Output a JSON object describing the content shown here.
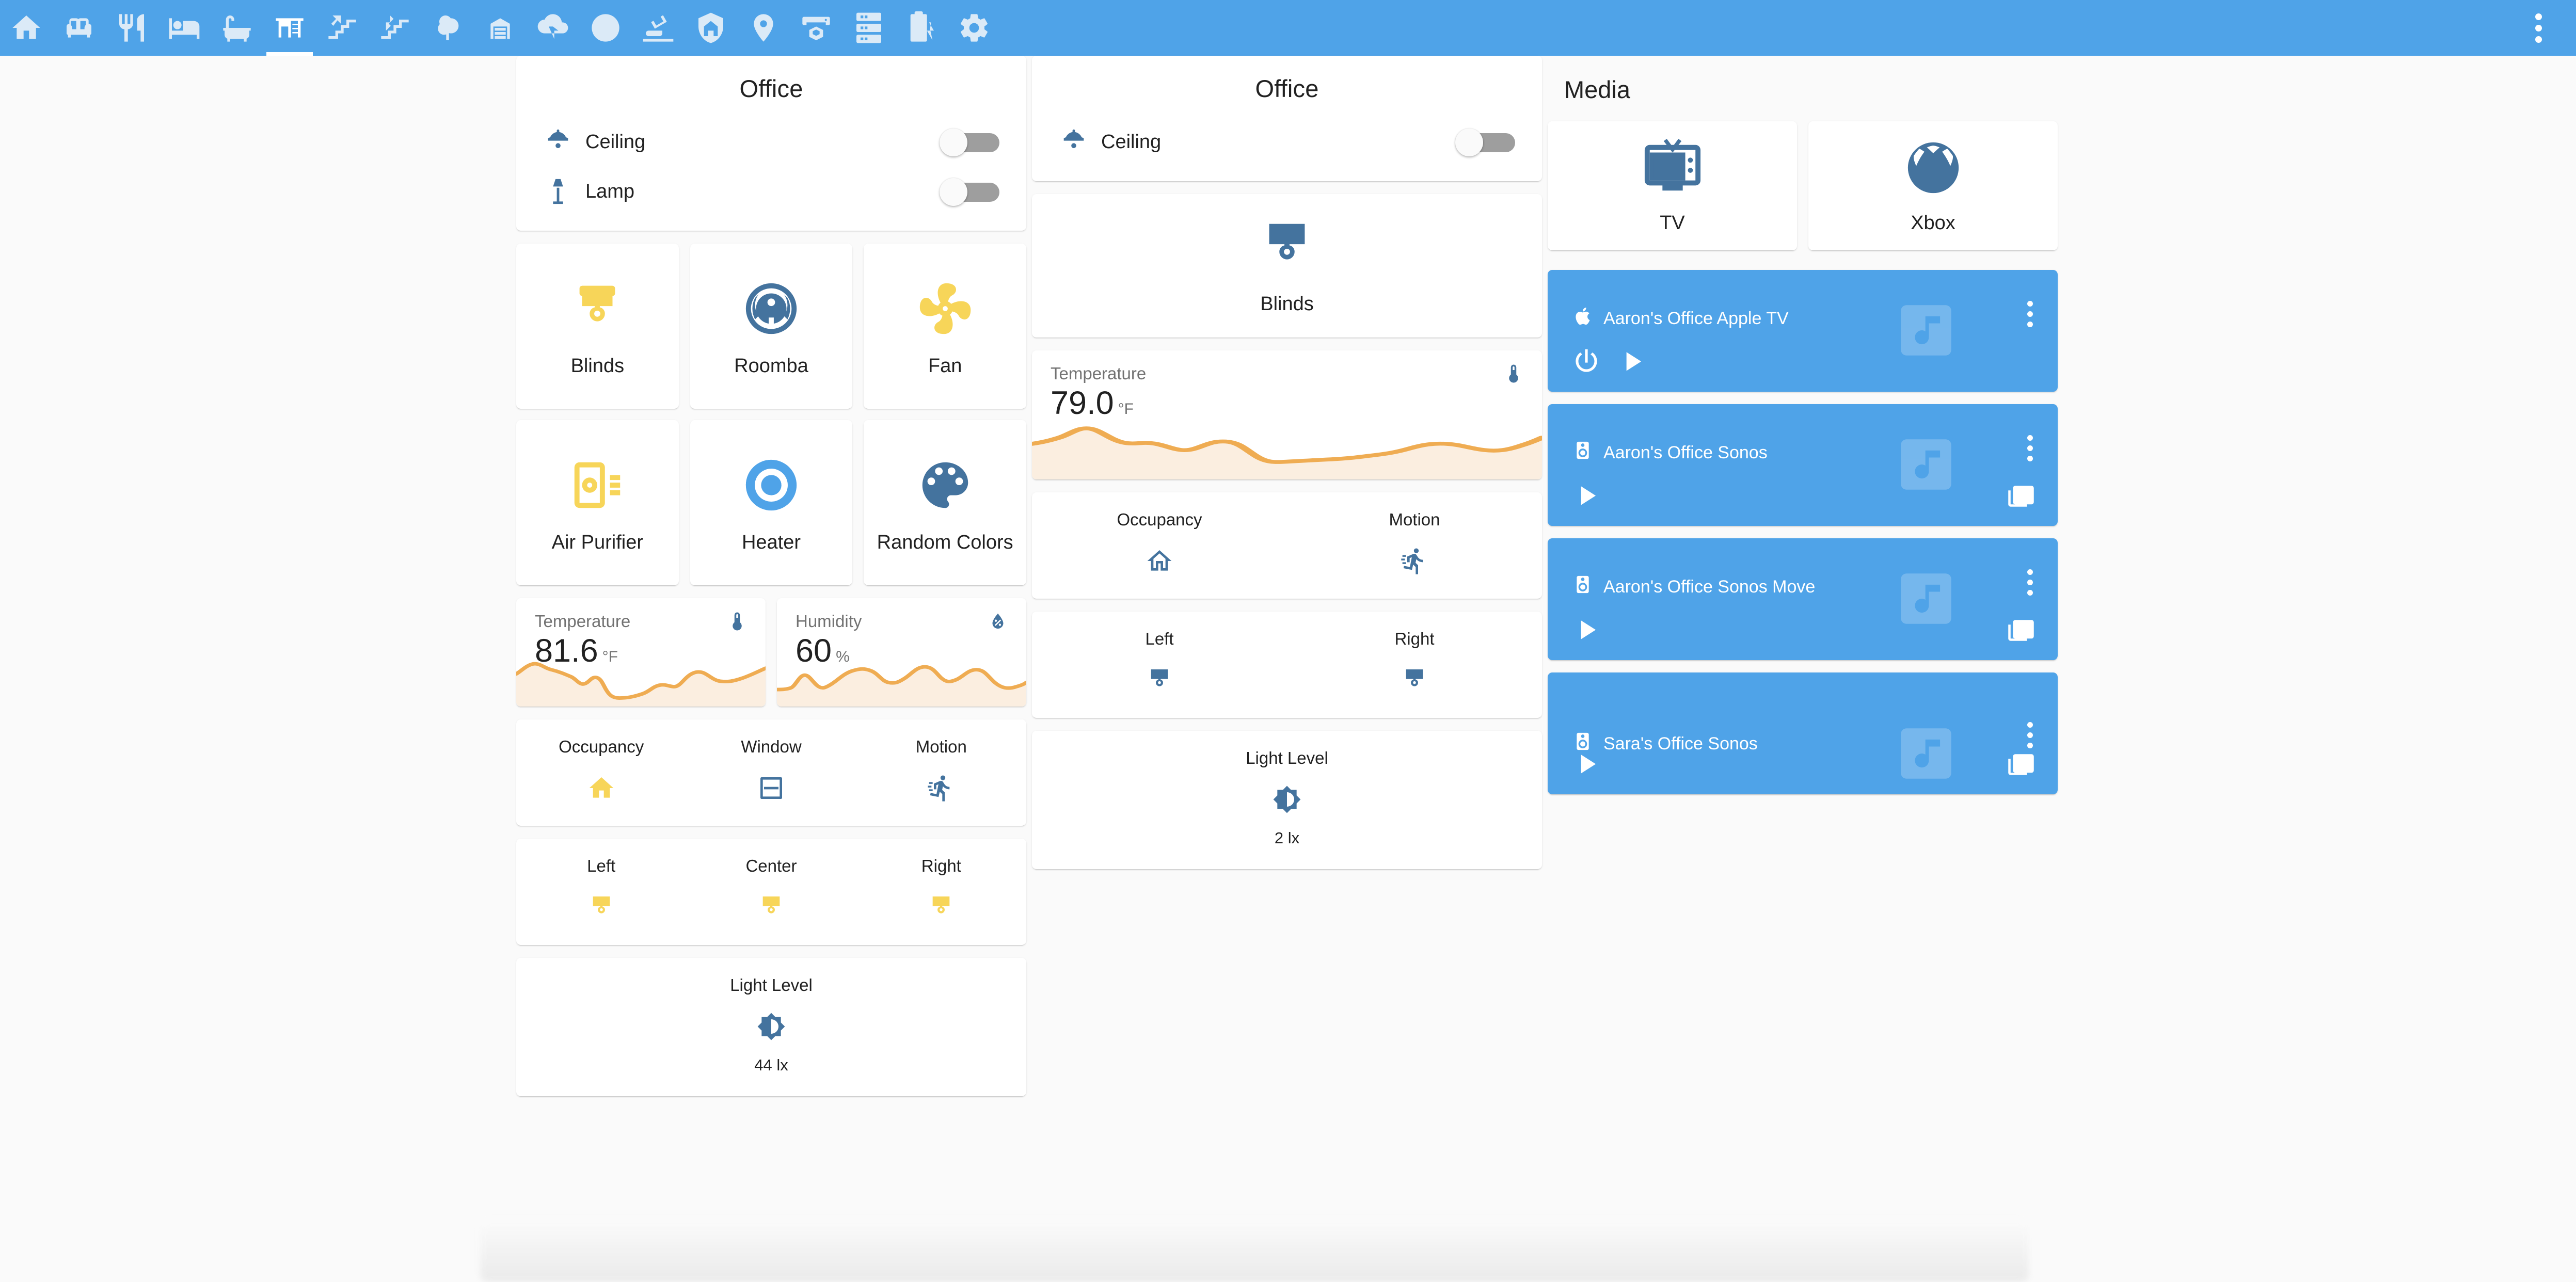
{
  "appbar": {
    "background": "#4fa3e8",
    "tabs": [
      {
        "icon": "home-icon",
        "name": "tab-home",
        "active": false
      },
      {
        "icon": "sofa-icon",
        "name": "tab-living-room",
        "active": false
      },
      {
        "icon": "silverware-fork-knife-icon",
        "name": "tab-kitchen",
        "active": false
      },
      {
        "icon": "bed-icon",
        "name": "tab-bedroom",
        "active": false
      },
      {
        "icon": "bathtub-icon",
        "name": "tab-bathroom",
        "active": false
      },
      {
        "icon": "desk-icon",
        "name": "tab-office",
        "active": true
      },
      {
        "icon": "stairs-down-icon",
        "name": "tab-downstairs",
        "active": false
      },
      {
        "icon": "stairs-up-icon",
        "name": "tab-upstairs",
        "active": false
      },
      {
        "icon": "tree-icon",
        "name": "tab-outside",
        "active": false
      },
      {
        "icon": "garage-icon",
        "name": "tab-garage",
        "active": false
      },
      {
        "icon": "weather-lightning-icon",
        "name": "tab-weather",
        "active": false
      },
      {
        "icon": "play-circle-outline-icon",
        "name": "tab-media",
        "active": false
      },
      {
        "icon": "cctv-icon",
        "name": "tab-cameras",
        "active": false
      },
      {
        "icon": "shield-home-icon",
        "name": "tab-security",
        "active": false
      },
      {
        "icon": "map-marker-icon",
        "name": "tab-locations",
        "active": false
      },
      {
        "icon": "printer-3d-icon",
        "name": "tab-3d-printer",
        "active": false
      },
      {
        "icon": "server-icon",
        "name": "tab-server",
        "active": false
      },
      {
        "icon": "battery-charging-icon",
        "name": "tab-batteries",
        "active": false
      },
      {
        "icon": "cog-icon",
        "name": "tab-settings",
        "active": false
      }
    ],
    "overflow_menu": "dots-vertical-icon"
  },
  "column1": {
    "lights_card": {
      "title": "Office",
      "rows": [
        {
          "icon": "ceiling-light-icon",
          "name": "Ceiling",
          "toggle": "off"
        },
        {
          "icon": "floor-lamp-icon",
          "name": "Lamp",
          "toggle": "off"
        }
      ]
    },
    "buttons": [
      {
        "icon": "roller-shade-icon",
        "label": "Blinds",
        "color": "#f7d559"
      },
      {
        "icon": "robot-vacuum-icon",
        "label": "Roomba",
        "color": "#44739e"
      },
      {
        "icon": "fan-icon",
        "label": "Fan",
        "color": "#f7d559"
      },
      {
        "icon": "air-purifier-icon",
        "label": "Air Purifier",
        "color": "#f7d559"
      },
      {
        "icon": "radiator-icon",
        "label": "Heater",
        "color": "#4fa3e8"
      },
      {
        "icon": "palette-icon",
        "label": "Random Colors",
        "color": "#44739e"
      }
    ],
    "sensors": [
      {
        "icon": "thermometer-icon",
        "name": "Temperature",
        "value": "81.6",
        "unit": "°F"
      },
      {
        "icon": "water-percent-icon",
        "name": "Humidity",
        "value": "60",
        "unit": "%"
      }
    ],
    "glance_binary": [
      {
        "name": "Occupancy",
        "icon": "home-icon",
        "color": "#f7d559"
      },
      {
        "name": "Window",
        "icon": "window-closed-icon",
        "color": "#44739e"
      },
      {
        "name": "Motion",
        "icon": "run-icon",
        "color": "#44739e"
      }
    ],
    "glance_covers": [
      {
        "name": "Left",
        "icon": "roller-shade-icon",
        "color": "#f7d559"
      },
      {
        "name": "Center",
        "icon": "roller-shade-icon",
        "color": "#f7d559"
      },
      {
        "name": "Right",
        "icon": "roller-shade-icon",
        "color": "#f7d559"
      }
    ],
    "glance_light": [
      {
        "name": "Light Level",
        "icon": "brightness-6-icon",
        "color": "#44739e",
        "state": "44 lx"
      }
    ]
  },
  "column2": {
    "lights_card": {
      "title": "Office",
      "rows": [
        {
          "icon": "ceiling-light-icon",
          "name": "Ceiling",
          "toggle": "off"
        }
      ]
    },
    "blinds_button": {
      "icon": "roller-shade-icon",
      "label": "Blinds",
      "color": "#44739e"
    },
    "sensor": {
      "icon": "thermometer-icon",
      "name": "Temperature",
      "value": "79.0",
      "unit": "°F"
    },
    "glance_binary": [
      {
        "name": "Occupancy",
        "icon": "home-outline-icon",
        "color": "#44739e"
      },
      {
        "name": "Motion",
        "icon": "run-icon",
        "color": "#44739e"
      }
    ],
    "glance_covers": [
      {
        "name": "Left",
        "icon": "roller-shade-icon",
        "color": "#44739e"
      },
      {
        "name": "Right",
        "icon": "roller-shade-icon",
        "color": "#44739e"
      }
    ],
    "glance_light": [
      {
        "name": "Light Level",
        "icon": "brightness-6-icon",
        "color": "#44739e",
        "state": "2 lx"
      }
    ]
  },
  "column3": {
    "header": "Media",
    "tiles": [
      {
        "icon": "television-classic-icon",
        "label": "TV"
      },
      {
        "icon": "microsoft-xbox-icon",
        "label": "Xbox"
      }
    ],
    "players": [
      {
        "icon": "apple-icon",
        "title": "Aaron's Office Apple TV",
        "watermark": "music-box-icon",
        "controls": [
          "power-icon",
          "play-icon"
        ],
        "cast": null,
        "title_low": false
      },
      {
        "icon": "speaker-icon",
        "title": "Aaron's Office Sonos",
        "watermark": "music-box-icon",
        "controls": [
          "play-icon"
        ],
        "cast": "play-box-multiple-icon",
        "title_low": false
      },
      {
        "icon": "speaker-icon",
        "title": "Aaron's Office Sonos Move",
        "watermark": "music-box-icon",
        "controls": [
          "play-icon"
        ],
        "cast": "play-box-multiple-icon",
        "title_low": false
      },
      {
        "icon": "speaker-icon",
        "title": "Sara's Office Sonos",
        "watermark": "music-box-icon",
        "controls": [
          "play-icon"
        ],
        "cast": "play-box-multiple-icon",
        "title_low": true
      }
    ]
  },
  "chart_data": [
    {
      "type": "area",
      "title": "Temperature",
      "ylabel": "°F",
      "current_value": 81.6,
      "unit": "°F",
      "line_color": "#efac52",
      "fill_color": "#fbeee0",
      "values": [
        74,
        77,
        80,
        78,
        77,
        76,
        74,
        70,
        66,
        69,
        71,
        68,
        62,
        60,
        59,
        60,
        61,
        62,
        64,
        67,
        68,
        67,
        66,
        68,
        72,
        76,
        78,
        76,
        73,
        72,
        74,
        79,
        82
      ],
      "grid": false
    },
    {
      "type": "area",
      "title": "Humidity",
      "ylabel": "%",
      "current_value": 60,
      "unit": "%",
      "line_color": "#efac52",
      "fill_color": "#fbeee0",
      "values": [
        52,
        53,
        56,
        63,
        70,
        66,
        57,
        55,
        60,
        66,
        71,
        74,
        73,
        70,
        66,
        63,
        62,
        65,
        70,
        76,
        78,
        74,
        68,
        65,
        68,
        73,
        75,
        72,
        67,
        62,
        58,
        56,
        60
      ],
      "grid": false
    },
    {
      "type": "area",
      "title": "Temperature",
      "ylabel": "°F",
      "current_value": 79.0,
      "unit": "°F",
      "line_color": "#efac52",
      "fill_color": "#fbeee0",
      "values": [
        70,
        71,
        75,
        80,
        82,
        79,
        73,
        70,
        71,
        70,
        66,
        64,
        66,
        71,
        70,
        64,
        58,
        56,
        56,
        57,
        58,
        58,
        59,
        61,
        63,
        64,
        64,
        67,
        71,
        72,
        70,
        68,
        70,
        76,
        80
      ],
      "grid": false
    }
  ]
}
